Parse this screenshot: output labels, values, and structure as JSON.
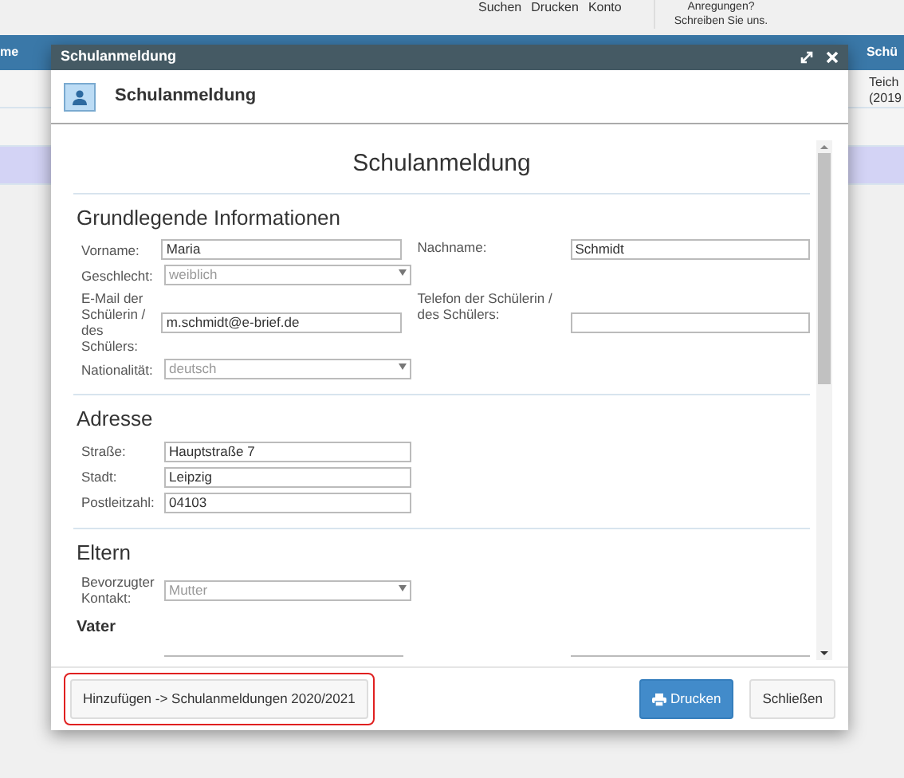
{
  "toolbar": {
    "items": [
      "Suchen",
      "Drucken",
      "Konto"
    ],
    "feedback": [
      "Anregungen?",
      "Schreiben Sie uns."
    ]
  },
  "background_table": {
    "header_left": "me",
    "header_right": "Schü",
    "rows": [
      {
        "text": "Teich (2019",
        "selected": false
      },
      {
        "selected": false
      },
      {
        "selected": true
      }
    ]
  },
  "modal": {
    "title": "Schulanmeldung",
    "header_title": "Schulanmeldung",
    "form_title": "Schulanmeldung",
    "sections": [
      {
        "heading": "Grundlegende Informationen",
        "rows": [
          [
            {
              "kind": "text",
              "label": "Vorname:",
              "value": "Maria"
            },
            {
              "kind": "text",
              "label": "Nachname:",
              "value": "Schmidt"
            }
          ],
          [
            {
              "kind": "select",
              "label": "Geschlecht:",
              "value": "weiblich"
            }
          ],
          [
            {
              "kind": "text",
              "label": "E-Mail der Schülerin / des Schülers:",
              "value": "m.schmidt@e-brief.de"
            },
            {
              "kind": "text",
              "label": "Telefon der Schülerin / des Schülers:"
            }
          ],
          [
            {
              "kind": "select",
              "label": "Nationalität:",
              "value": "deutsch"
            }
          ]
        ]
      },
      {
        "heading": "Adresse",
        "rows": [
          [
            {
              "kind": "text",
              "label": "Straße:",
              "value": "Hauptstraße 7"
            }
          ],
          [
            {
              "kind": "text",
              "label": "Stadt:",
              "value": "Leipzig"
            }
          ],
          [
            {
              "kind": "text",
              "label": "Postleitzahl:",
              "value": "04103"
            }
          ]
        ]
      },
      {
        "heading": "Eltern",
        "rows": [
          [
            {
              "kind": "select",
              "label": "Bevorzugter Kontakt:",
              "value": "Mutter"
            }
          ]
        ],
        "subheading": "Vater"
      }
    ],
    "footer_buttons": [
      {
        "label": "Hinzufügen -> Schulanmeldungen 2020/2021",
        "kind": "secondary",
        "highlighted": true
      },
      {
        "label": "Drucken",
        "kind": "primary",
        "highlighted": false
      },
      {
        "label": "Schließen",
        "kind": "secondary",
        "highlighted": false
      }
    ]
  }
}
